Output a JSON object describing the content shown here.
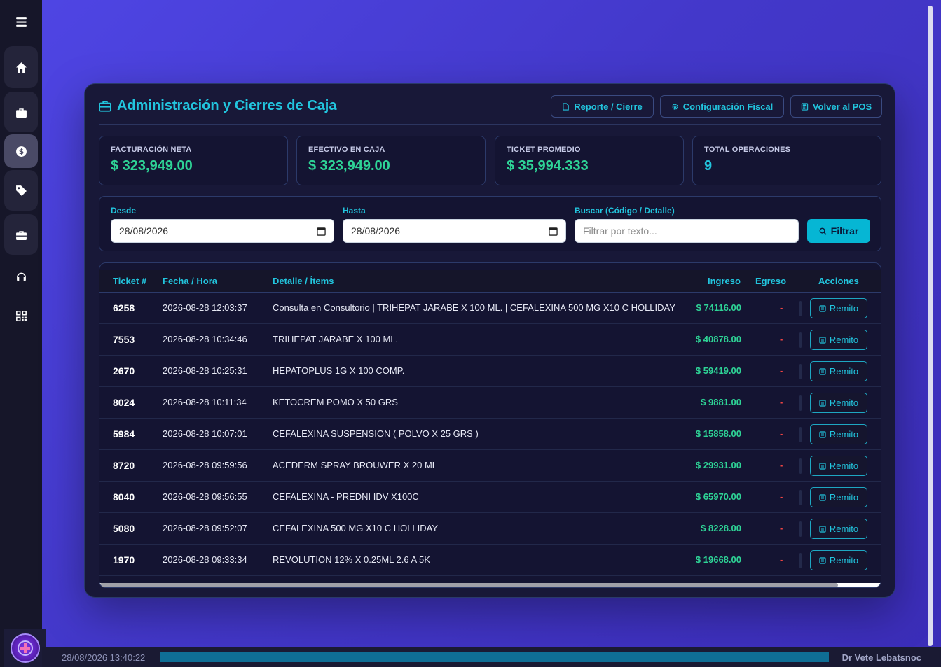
{
  "sidebar": {
    "items": [
      {
        "icon": "menu-icon"
      },
      {
        "icon": "home-icon"
      },
      {
        "icon": "briefcase-icon"
      },
      {
        "icon": "dollar-icon"
      },
      {
        "icon": "tag-icon"
      },
      {
        "icon": "toolbox-icon"
      },
      {
        "icon": "headset-icon"
      },
      {
        "icon": "qrcode-icon"
      }
    ]
  },
  "header": {
    "title": "Administración y Cierres de Caja",
    "btn_report": "Reporte / Cierre",
    "btn_fiscal": "Configuración Fiscal",
    "btn_pos": "Volver al POS"
  },
  "stats": {
    "net_label": "FACTURACIÓN NETA",
    "net_value": "$ 323,949.00",
    "cash_label": "EFECTIVO EN CAJA",
    "cash_value": "$ 323,949.00",
    "avg_label": "TICKET PROMEDIO",
    "avg_value": "$ 35,994.333",
    "ops_label": "TOTAL OPERACIONES",
    "ops_value": "9"
  },
  "filters": {
    "from_label": "Desde",
    "from_value": "28/08/2026",
    "to_label": "Hasta",
    "to_value": "28/08/2026",
    "search_label": "Buscar (Código / Detalle)",
    "search_placeholder": "Filtrar por texto...",
    "filter_btn": "Filtrar"
  },
  "table": {
    "headers": {
      "ticket": "Ticket #",
      "fecha": "Fecha / Hora",
      "detalle": "Detalle / Ítems",
      "ingreso": "Ingreso",
      "egreso": "Egreso",
      "acciones": "Acciones"
    },
    "action_label": "Remito",
    "rows": [
      {
        "ticket": "6258",
        "fecha": "2026-08-28 12:03:37",
        "detalle": "Consulta en Consultorio | TRIHEPAT JARABE X 100 ML. | CEFALEXINA 500 MG X10 C HOLLIDAY",
        "ingreso": "$ 74116.00",
        "egreso": "-"
      },
      {
        "ticket": "7553",
        "fecha": "2026-08-28 10:34:46",
        "detalle": "TRIHEPAT JARABE X 100 ML.",
        "ingreso": "$ 40878.00",
        "egreso": "-"
      },
      {
        "ticket": "2670",
        "fecha": "2026-08-28 10:25:31",
        "detalle": "HEPATOPLUS 1G X 100 COMP.",
        "ingreso": "$ 59419.00",
        "egreso": "-"
      },
      {
        "ticket": "8024",
        "fecha": "2026-08-28 10:11:34",
        "detalle": "KETOCREM POMO X 50 GRS",
        "ingreso": "$ 9881.00",
        "egreso": "-"
      },
      {
        "ticket": "5984",
        "fecha": "2026-08-28 10:07:01",
        "detalle": "CEFALEXINA SUSPENSION ( POLVO X 25 GRS )",
        "ingreso": "$ 15858.00",
        "egreso": "-"
      },
      {
        "ticket": "8720",
        "fecha": "2026-08-28 09:59:56",
        "detalle": "ACEDERM SPRAY BROUWER X 20 ML",
        "ingreso": "$ 29931.00",
        "egreso": "-"
      },
      {
        "ticket": "8040",
        "fecha": "2026-08-28 09:56:55",
        "detalle": "CEFALEXINA - PREDNI IDV X100C",
        "ingreso": "$ 65970.00",
        "egreso": "-"
      },
      {
        "ticket": "5080",
        "fecha": "2026-08-28 09:52:07",
        "detalle": "CEFALEXINA 500 MG X10 C HOLLIDAY",
        "ingreso": "$ 8228.00",
        "egreso": "-"
      },
      {
        "ticket": "1970",
        "fecha": "2026-08-28 09:33:34",
        "detalle": "REVOLUTION 12% X 0.25ML 2.6 A 5K",
        "ingreso": "$ 19668.00",
        "egreso": "-"
      }
    ]
  },
  "statusbar": {
    "datetime": "28/08/2026 13:40:22",
    "user": "Dr Vete Lebatsnoc"
  },
  "colors": {
    "accent": "#22c5de",
    "positive": "#2ed396",
    "negative": "#ef4444",
    "background_from": "#4f46e5",
    "background_to": "#3b2db8"
  }
}
